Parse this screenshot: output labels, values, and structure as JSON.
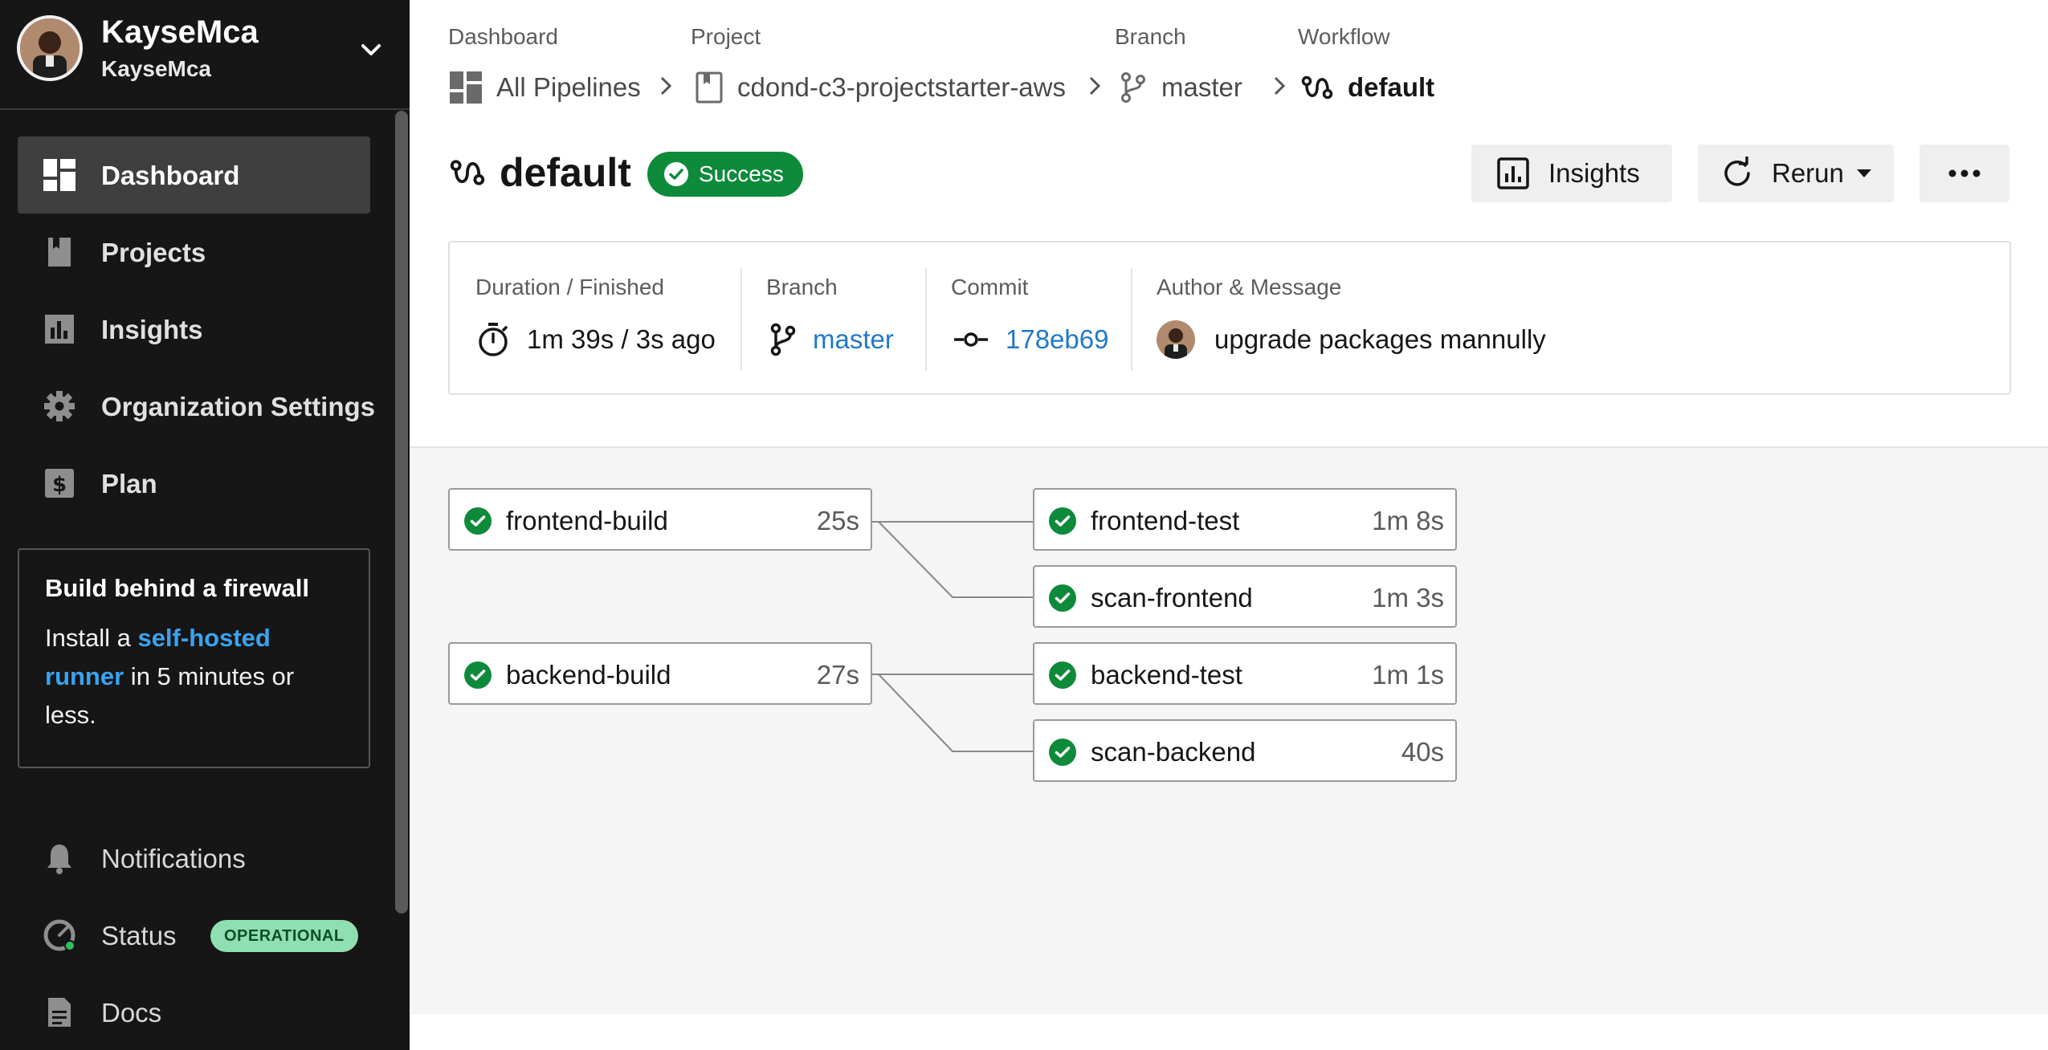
{
  "sidebar": {
    "org_name": "KayseMca",
    "org_sub": "KayseMca",
    "items": [
      {
        "label": "Dashboard",
        "icon": "dashboard-icon"
      },
      {
        "label": "Projects",
        "icon": "book-icon"
      },
      {
        "label": "Insights",
        "icon": "bar-chart-icon"
      },
      {
        "label": "Organization Settings",
        "icon": "gear-icon"
      },
      {
        "label": "Plan",
        "icon": "dollar-icon"
      }
    ],
    "promo": {
      "title": "Build behind a firewall",
      "text_before": "Install a ",
      "link": "self-hosted runner",
      "text_after": " in 5 minutes or less."
    },
    "footer": {
      "notifications": "Notifications",
      "status": "Status",
      "status_badge": "OPERATIONAL",
      "docs": "Docs"
    }
  },
  "breadcrumb": {
    "dashboard_cap": "Dashboard",
    "dashboard": "All Pipelines",
    "project_cap": "Project",
    "project": "cdond-c3-projectstarter-aws",
    "branch_cap": "Branch",
    "branch": "master",
    "workflow_cap": "Workflow",
    "workflow": "default"
  },
  "workflow": {
    "title": "default",
    "status": "Success",
    "status_color": "#0e8a3b"
  },
  "actions": {
    "insights": "Insights",
    "rerun": "Rerun",
    "more": "more-icon"
  },
  "info": {
    "duration_cap": "Duration / Finished",
    "duration": "1m 39s / 3s ago",
    "branch_cap": "Branch",
    "branch": "master",
    "commit_cap": "Commit",
    "commit": "178eb69",
    "author_cap": "Author & Message",
    "message": "upgrade packages mannully"
  },
  "jobs": [
    {
      "name": "frontend-build",
      "duration": "25s"
    },
    {
      "name": "frontend-test",
      "duration": "1m 8s"
    },
    {
      "name": "scan-frontend",
      "duration": "1m 3s"
    },
    {
      "name": "backend-build",
      "duration": "27s"
    },
    {
      "name": "backend-test",
      "duration": "1m 1s"
    },
    {
      "name": "scan-backend",
      "duration": "40s"
    }
  ],
  "colors": {
    "sidebar_bg": "#161616",
    "success": "#0e8a3b",
    "link": "#1f79c8"
  }
}
